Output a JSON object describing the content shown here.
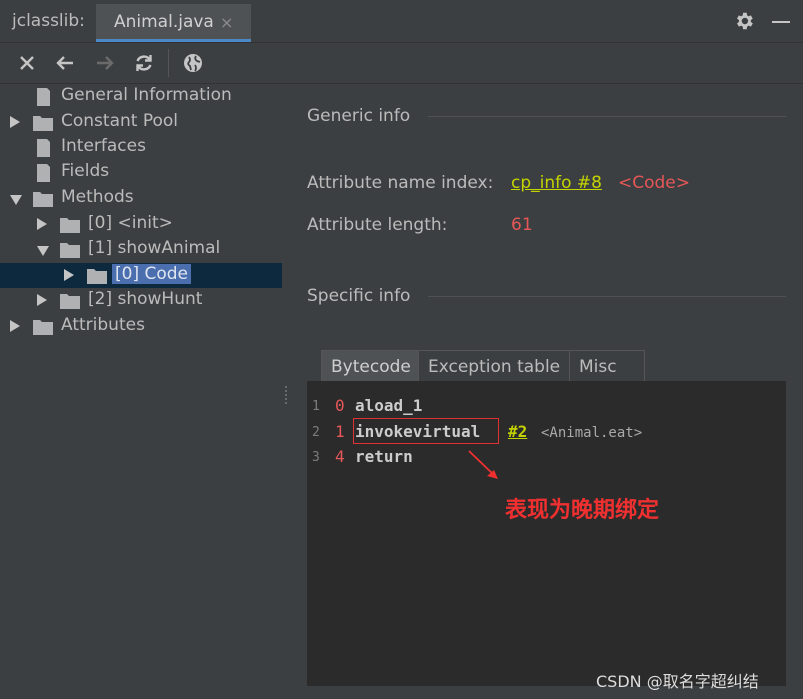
{
  "titlebar": {
    "app_label": "jclasslib:",
    "tab_label": "Animal.java",
    "tab_close": "×",
    "settings_icon": "gear-icon",
    "minimize_icon": "minimize-icon"
  },
  "toolbar": {
    "icons": [
      "close-icon",
      "back-icon",
      "forward-icon",
      "refresh-icon",
      "browser-icon"
    ]
  },
  "tree": {
    "items": [
      {
        "label": "General Information",
        "level": 0,
        "icon": "file",
        "arrow": "none"
      },
      {
        "label": "Constant Pool",
        "level": 0,
        "icon": "folder",
        "arrow": "right"
      },
      {
        "label": "Interfaces",
        "level": 0,
        "icon": "file",
        "arrow": "none"
      },
      {
        "label": "Fields",
        "level": 0,
        "icon": "file",
        "arrow": "none"
      },
      {
        "label": "Methods",
        "level": 0,
        "icon": "folder",
        "arrow": "down"
      },
      {
        "label": "[0] <init>",
        "level": 1,
        "icon": "folder",
        "arrow": "right"
      },
      {
        "label": "[1] showAnimal",
        "level": 1,
        "icon": "folder",
        "arrow": "down"
      },
      {
        "label": "[0] Code",
        "level": 2,
        "icon": "folder",
        "arrow": "right",
        "selected": true
      },
      {
        "label": "[2] showHunt",
        "level": 1,
        "icon": "folder",
        "arrow": "right"
      },
      {
        "label": "Attributes",
        "level": 0,
        "icon": "folder",
        "arrow": "right"
      }
    ]
  },
  "generic_info": {
    "title": "Generic info",
    "name_index_label": "Attribute name index:",
    "name_index_link": "cp_info #8",
    "name_index_value": "<Code>",
    "length_label": "Attribute length:",
    "length_value": "61"
  },
  "specific_info": {
    "title": "Specific info",
    "tabs": [
      "Bytecode",
      "Exception table",
      "Misc"
    ],
    "active_tab": "Bytecode"
  },
  "bytecode": {
    "lines": [
      {
        "line": "1",
        "offset": "0",
        "opcode": "aload_1",
        "ref": "",
        "comment": ""
      },
      {
        "line": "2",
        "offset": "1",
        "opcode": "invokevirtual",
        "ref": "#2",
        "comment": "<Animal.eat>"
      },
      {
        "line": "3",
        "offset": "4",
        "opcode": "return",
        "ref": "",
        "comment": ""
      }
    ]
  },
  "annotation": {
    "text": "表现为晚期绑定",
    "color": "#f03030"
  },
  "watermark": "CSDN @取名字超纠结"
}
